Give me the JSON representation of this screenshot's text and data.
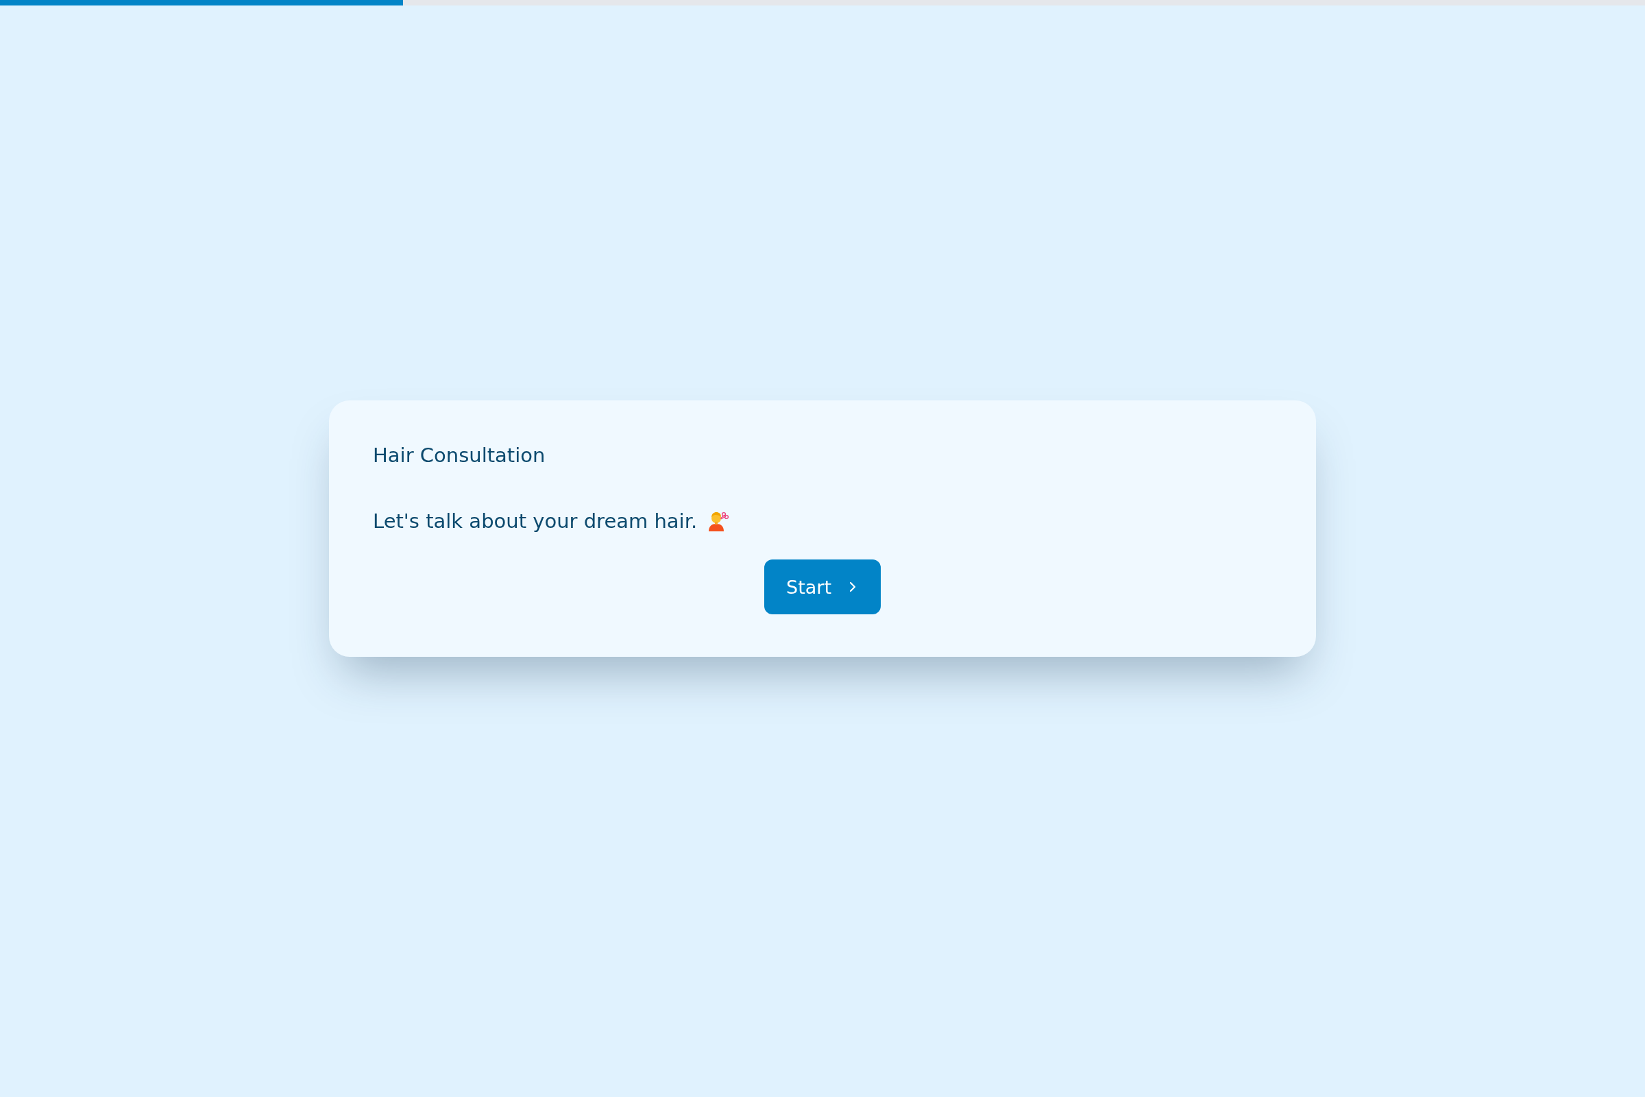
{
  "progress": {
    "level": 0.245
  },
  "card": {
    "title": "Hair Consultation",
    "message": "Let's talk about your dream hair.",
    "button": {
      "label": "Start"
    }
  }
}
